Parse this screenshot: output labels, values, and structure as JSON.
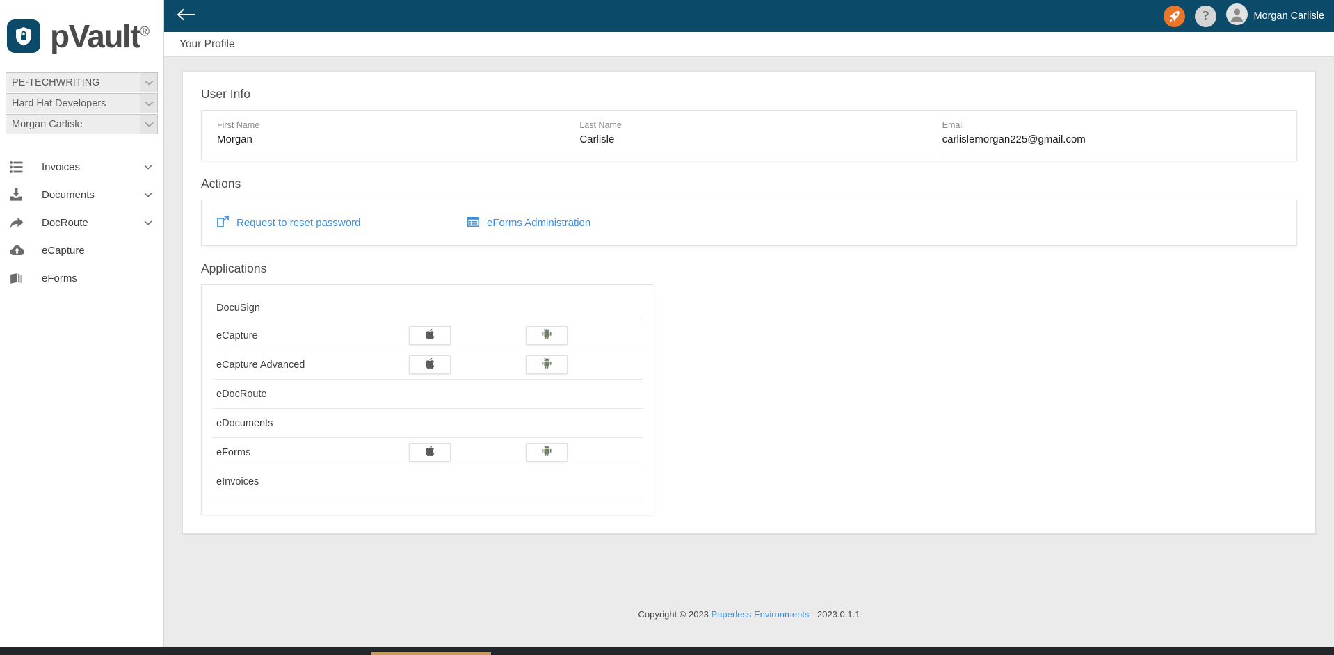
{
  "brand": {
    "name": "pVault",
    "registered": "®",
    "logo_icon": "shield-lock-icon",
    "logo_bg": "#0c4a69"
  },
  "sidebar": {
    "selects": [
      {
        "value": "PE-TECHWRITING",
        "caret": "chevron-down-icon"
      },
      {
        "value": "Hard Hat Developers",
        "caret": "chevron-down-icon"
      },
      {
        "value": "Morgan Carlisle",
        "caret": "chevron-down-icon"
      }
    ],
    "nav": [
      {
        "label": "Invoices",
        "icon": "list-icon",
        "has_caret": true
      },
      {
        "label": "Documents",
        "icon": "inbox-download-icon",
        "has_caret": true
      },
      {
        "label": "DocRoute",
        "icon": "forward-arrow-icon",
        "has_caret": true
      },
      {
        "label": "eCapture",
        "icon": "cloud-upload-icon",
        "has_caret": false
      },
      {
        "label": "eForms",
        "icon": "book-icon",
        "has_caret": false
      }
    ]
  },
  "topbar": {
    "back_icon": "arrow-left-icon",
    "background": "#0c4a69",
    "rocket_icon": "rocket-icon",
    "rocket_bg": "#e8752a",
    "help_icon": "help-question-icon",
    "help_label": "?",
    "avatar_icon": "user-avatar-icon",
    "user_name": "Morgan Carlisle"
  },
  "subbar": {
    "title": "Your Profile"
  },
  "user_info": {
    "section_title": "User Info",
    "fields": [
      {
        "label": "First Name",
        "value": "Morgan",
        "placeholder": "First Name"
      },
      {
        "label": "Last Name",
        "value": "Carlisle",
        "placeholder": "Last Name"
      },
      {
        "label": "Email",
        "value": "carlislemorgan225@gmail.com",
        "placeholder": "Email"
      }
    ]
  },
  "actions": {
    "section_title": "Actions",
    "items": [
      {
        "label": "Request to reset password",
        "icon": "external-link-icon"
      },
      {
        "label": "eForms Administration",
        "icon": "form-list-icon"
      }
    ],
    "link_color": "#3b8ede"
  },
  "applications": {
    "section_title": "Applications",
    "apple_icon": "apple-icon",
    "android_icon": "android-icon",
    "rows": [
      {
        "name": "DocuSign",
        "apple": false,
        "android": false
      },
      {
        "name": "eCapture",
        "apple": true,
        "android": true
      },
      {
        "name": "eCapture Advanced",
        "apple": true,
        "android": true
      },
      {
        "name": "eDocRoute",
        "apple": false,
        "android": false
      },
      {
        "name": "eDocuments",
        "apple": false,
        "android": false
      },
      {
        "name": "eForms",
        "apple": true,
        "android": true
      },
      {
        "name": "eInvoices",
        "apple": false,
        "android": false
      }
    ]
  },
  "footer": {
    "prefix": "Copyright © 2023 ",
    "company": "Paperless Environments",
    "suffix": " - 2023.0.1.1"
  }
}
